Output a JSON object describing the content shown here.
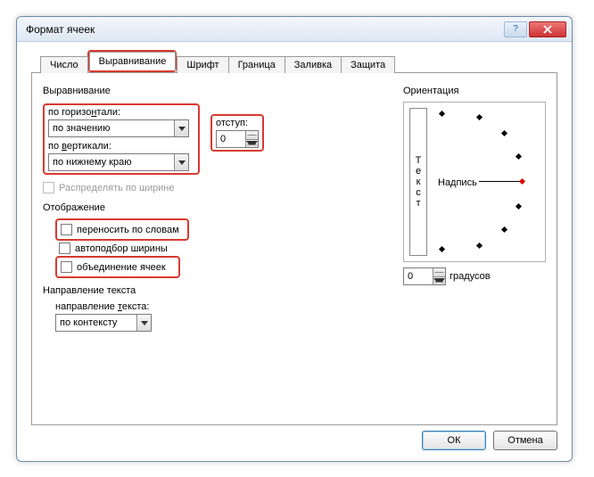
{
  "window": {
    "title": "Формат ячеек"
  },
  "tabs": [
    "Число",
    "Выравнивание",
    "Шрифт",
    "Граница",
    "Заливка",
    "Защита"
  ],
  "active_tab": 1,
  "align": {
    "group": "Выравнивание",
    "horiz_label": "по горизонтали:",
    "horiz_value": "по значению",
    "vert_label": "по вертикали:",
    "vert_value": "по нижнему краю",
    "indent_label": "отступ:",
    "indent_value": "0",
    "distribute": "Распределять по ширине"
  },
  "display": {
    "group": "Отображение",
    "wrap": "переносить по словам",
    "shrink": "автоподбор ширины",
    "merge": "объединение ячеек"
  },
  "textdir": {
    "group": "Направление текста",
    "label": "направление текста:",
    "value": "по контексту"
  },
  "orient": {
    "group": "Ориентация",
    "vtext": [
      "Т",
      "е",
      "к",
      "с",
      "т"
    ],
    "label": "Надпись",
    "degrees_value": "0",
    "degrees_label": "градусов"
  },
  "buttons": {
    "ok": "ОК",
    "cancel": "Отмена"
  }
}
